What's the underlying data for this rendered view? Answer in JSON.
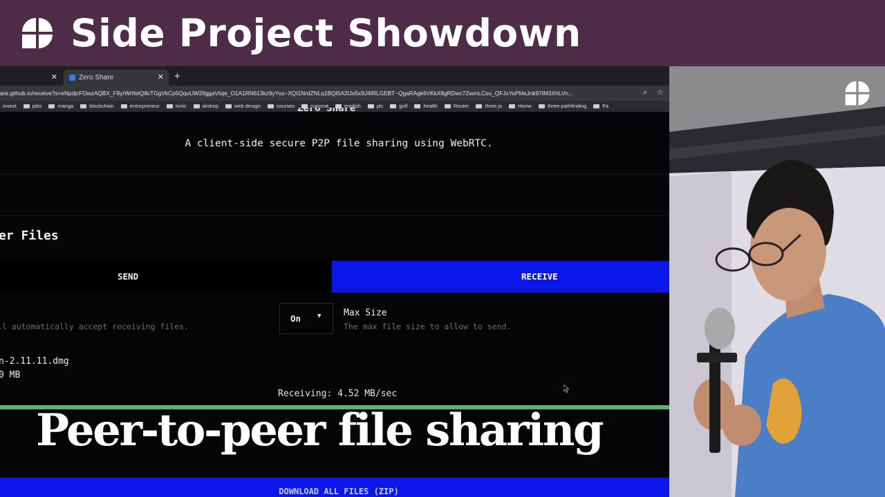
{
  "banner": {
    "title": "Side Project Showdown",
    "background": "#4e2c47",
    "logo_icon": "four-petal-logo"
  },
  "browser": {
    "tabs": [
      {
        "label": ""
      },
      {
        "label": "Zero Share"
      }
    ],
    "url": "are.github.io/receive?s=eNpdjcFOwzAQBX_F9yrWrtfetQ8cTGgVkCp5QquUW2IlggaVloje_O1A1RN613kz9yYva~XQI1NrdZNLq1BQI5A2IJo5x9J4IRLGEBT~QgaRAgk6VKkX8gRDwc7ZwmLCou_QFJxYoPMsJnk97IM3XhLVn...",
    "bookmarks": [
      "invest",
      "jobs",
      "manga",
      "blockchain",
      "entrepreneur",
      "Ionic",
      "airdrop",
      "web design",
      "courses",
      "ruamrat",
      "english",
      "plc",
      "golf",
      "health",
      "Router",
      "three.js",
      "Home",
      "three-pathfinding",
      "Fa"
    ]
  },
  "page": {
    "heading": "Zero Share",
    "subtitle": "A client-side secure P2P file sharing using WebRTC.",
    "section_title": "er Files",
    "tabs": {
      "send": "SEND",
      "receive": "RECEIVE"
    },
    "auto_accept_desc": "ll automatically accept receiving files.",
    "auto_accept_value": "On",
    "max_size_label": "Max Size",
    "max_size_desc": "The max file size to allow to send.",
    "file_name": "n-2.11.11.dmg",
    "file_size": "0 MB",
    "receiving_status": "Receiving: 4.52 MB/sec",
    "progress": 1.0,
    "download_button": "DOWNLOAD ALL FILES (ZIP)",
    "accent_color": "#0b17e8",
    "progress_color": "#5ab66a"
  },
  "caption": "Peer-to-peer file sharing"
}
